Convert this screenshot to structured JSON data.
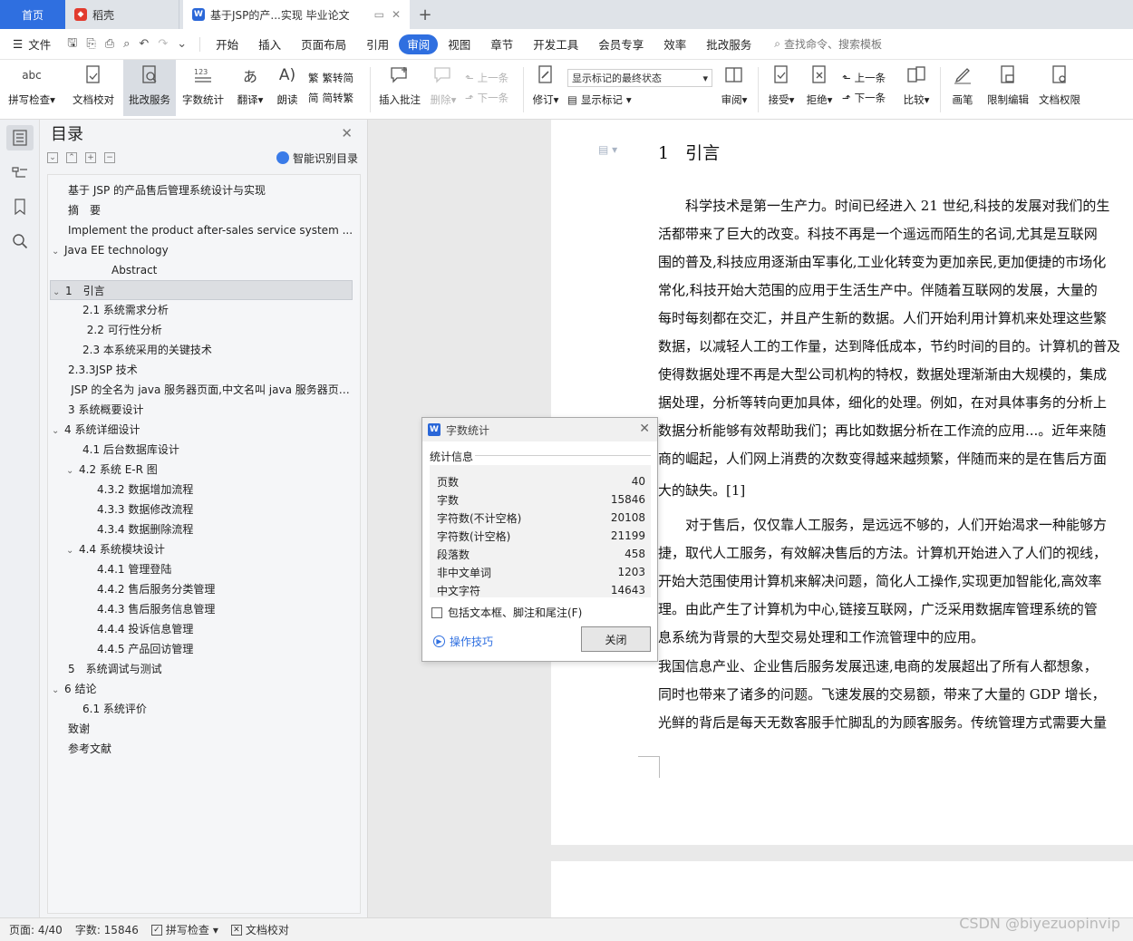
{
  "tabs": {
    "home": "首页",
    "daoke": "稻壳",
    "doc_title": "基于JSP的产...实现 毕业论文",
    "plus": "+"
  },
  "menubar": {
    "file": "文件",
    "items": [
      "开始",
      "插入",
      "页面布局",
      "引用",
      "审阅",
      "视图",
      "章节",
      "开发工具",
      "会员专享",
      "效率",
      "批改服务"
    ],
    "active": "审阅",
    "search": "查找命令、搜索模板"
  },
  "ribbon": {
    "spell": "拼写检查",
    "doccheck": "文档校对",
    "grading": "批改服务",
    "wordcount": "字数统计",
    "translate": "翻译",
    "read": "朗读",
    "trad": "繁转简",
    "simp": "简转繁",
    "insert_comment": "插入批注",
    "delete": "删除",
    "prev": "上一条",
    "next": "下一条",
    "revise": "修订",
    "markup_state": "显示标记的最终状态",
    "show_markup": "显示标记",
    "review": "审阅",
    "accept": "接受",
    "reject": "拒绝",
    "prev2": "上一条",
    "next2": "下一条",
    "compare": "比较",
    "pen": "画笔",
    "restrict": "限制编辑",
    "perm": "文档权限"
  },
  "toc": {
    "title": "目录",
    "smart": "智能识别目录",
    "items": [
      {
        "text": "基于 JSP 的产品售后管理系统设计与实现",
        "indent": 0,
        "chev": ""
      },
      {
        "text": "摘　要",
        "indent": 0,
        "chev": ""
      },
      {
        "text": "Implement the product after-sales service system ...",
        "indent": 0,
        "chev": ""
      },
      {
        "text": "Java EE technology",
        "indent": 0,
        "chev": "v"
      },
      {
        "text": "Abstract",
        "indent": 3,
        "chev": ""
      },
      {
        "text": "1　引言",
        "indent": 0,
        "chev": "v"
      },
      {
        "text": "2.1  系统需求分析",
        "indent": 1,
        "chev": ""
      },
      {
        "text": "2.2  可行性分析",
        "indent": 1.3,
        "chev": ""
      },
      {
        "text": "2.3  本系统采用的关键技术",
        "indent": 1,
        "chev": ""
      },
      {
        "text": "2.3.3JSP 技术",
        "indent": 0,
        "chev": ""
      },
      {
        "text": "JSP 的全名为 java 服务器页面,中文名叫 java 服务器页 ...",
        "indent": 0.2,
        "chev": ""
      },
      {
        "text": "3  系统概要设计",
        "indent": 0,
        "chev": ""
      },
      {
        "text": "4  系统详细设计",
        "indent": 0,
        "chev": "v"
      },
      {
        "text": "4.1  后台数据库设计",
        "indent": 1,
        "chev": ""
      },
      {
        "text": "4.2  系统 E-R 图",
        "indent": 1,
        "chev": "v"
      },
      {
        "text": "4.3.2  数据增加流程",
        "indent": 2,
        "chev": ""
      },
      {
        "text": "4.3.3  数据修改流程",
        "indent": 2,
        "chev": ""
      },
      {
        "text": "4.3.4  数据删除流程",
        "indent": 2,
        "chev": ""
      },
      {
        "text": "4.4  系统模块设计",
        "indent": 1,
        "chev": "v"
      },
      {
        "text": "4.4.1 管理登陆",
        "indent": 2,
        "chev": ""
      },
      {
        "text": "4.4.2  售后服务分类管理",
        "indent": 2,
        "chev": ""
      },
      {
        "text": "4.4.3  售后服务信息管理",
        "indent": 2,
        "chev": ""
      },
      {
        "text": "4.4.4  投诉信息管理",
        "indent": 2,
        "chev": ""
      },
      {
        "text": "4.4.5  产品回访管理",
        "indent": 2,
        "chev": ""
      },
      {
        "text": "5　系统调试与测试",
        "indent": 0,
        "chev": ""
      },
      {
        "text": "6  结论",
        "indent": 0,
        "chev": "v"
      },
      {
        "text": "6.1 系统评价",
        "indent": 1,
        "chev": ""
      },
      {
        "text": "致谢",
        "indent": 0,
        "chev": ""
      },
      {
        "text": "参考文献",
        "indent": 0,
        "chev": ""
      }
    ]
  },
  "doc": {
    "heading_num": "1",
    "heading_text": "引言",
    "lines": [
      "　　科学技术是第一生产力。时间已经进入 21 世纪,科技的发展对我们的生",
      "活都带来了巨大的改变。科技不再是一个遥远而陌生的名词,尤其是互联网",
      "围的普及,科技应用逐渐由军事化,工业化转变为更加亲民,更加便捷的市场化",
      "常化,科技开始大范围的应用于生活生产中。伴随着互联网的发展，大量的",
      "每时每刻都在交汇，并且产生新的数据。人们开始利用计算机来处理这些繁",
      "数据，以减轻人工的工作量，达到降低成本，节约时间的目的。计算机的普及",
      "使得数据处理不再是大型公司机构的特权，数据处理渐渐由大规模的，集成",
      "据处理，分析等转向更加具体，细化的处理。例如，在对具体事务的分析上",
      "数据分析能够有效帮助我们；再比如数据分析在工作流的应用...。近年来随",
      "商的崛起，人们网上消费的次数变得越来越频繁，伴随而来的是在售后方面",
      "大的缺失。[1]",
      "　　对于售后，仅仅靠人工服务，是远远不够的，人们开始渴求一种能够方",
      "捷，取代人工服务，有效解决售后的方法。计算机开始进入了人们的视线，",
      "开始大范围使用计算机来解决问题，简化人工操作,实现更加智能化,高效率",
      "理。由此产生了计算机为中心,链接互联网，广泛采用数据库管理系统的管",
      "息系统为背景的大型交易处理和工作流管理中的应用。",
      "我国信息产业、企业售后服务发展迅速,电商的发展超出了所有人都想象，",
      "同时也带来了诸多的问题。飞速发展的交易额，带来了大量的 GDP 增长，",
      "光鲜的背后是每天无数客服手忙脚乱的为顾客服务。传统管理方式需要大量"
    ]
  },
  "dialog": {
    "title": "字数统计",
    "section": "统计信息",
    "rows": [
      {
        "label": "页数",
        "value": "40"
      },
      {
        "label": "字数",
        "value": "15846"
      },
      {
        "label": "字符数(不计空格)",
        "value": "20108"
      },
      {
        "label": "字符数(计空格)",
        "value": "21199"
      },
      {
        "label": "段落数",
        "value": "458"
      },
      {
        "label": "非中文单词",
        "value": "1203"
      },
      {
        "label": "中文字符",
        "value": "14643"
      }
    ],
    "checkbox": "包括文本框、脚注和尾注(F)",
    "tips": "操作技巧",
    "close": "关闭"
  },
  "statusbar": {
    "page": "页面: 4/40",
    "words": "字数: 15846",
    "spell": "拼写检查",
    "doccheck": "文档校对"
  },
  "watermark": "CSDN @biyezuopinvip",
  "colors": {
    "accent": "#2f6fe0",
    "tab_bar": "#dfe3e8"
  }
}
